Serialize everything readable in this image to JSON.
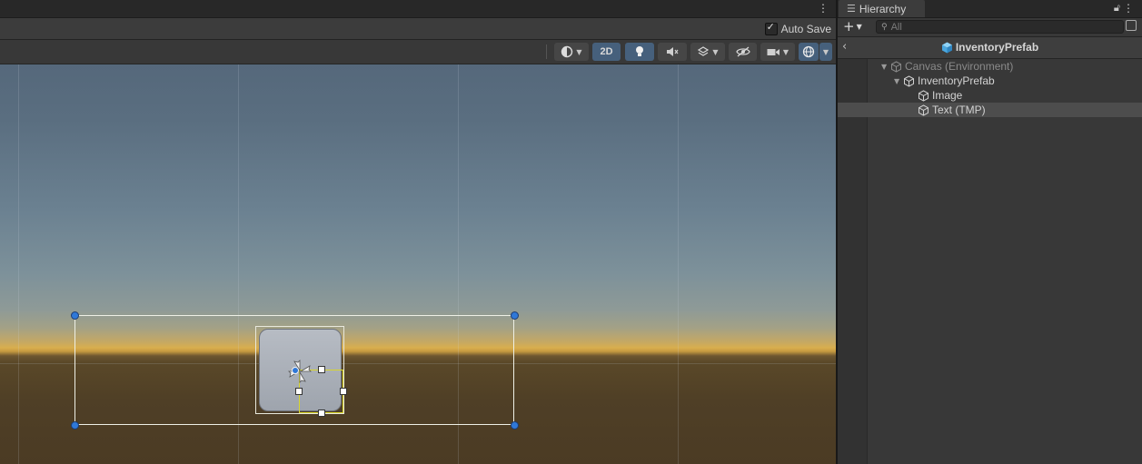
{
  "scene": {
    "autosave_label": "Auto Save",
    "autosave_checked": true,
    "toolbar": {
      "mode_2d_label": "2D",
      "mode_2d_active": true
    }
  },
  "hierarchy": {
    "tab_label": "Hierarchy",
    "search_placeholder": "All",
    "breadcrumb_title": "InventoryPrefab",
    "tree": [
      {
        "label": "Canvas (Environment)",
        "depth": 0,
        "expanded": true,
        "dimmed": true
      },
      {
        "label": "InventoryPrefab",
        "depth": 1,
        "expanded": true
      },
      {
        "label": "Image",
        "depth": 2
      },
      {
        "label": "Text (TMP)",
        "depth": 2,
        "selected": true
      }
    ]
  },
  "colors": {
    "accent_blue": "#46607c",
    "selection_yellow": "#d9d62b",
    "prefab_cube": "#5ab4ea"
  },
  "icons": {
    "scene_kebab": "kebab-menu-icon",
    "shading": "shading-mode-icon",
    "lighting": "lightbulb-icon",
    "audio": "audio-mute-icon",
    "effects": "effects-icon",
    "hidden": "scene-visibility-icon",
    "camera": "camera-icon",
    "gizmos": "gizmos-icon",
    "lock": "lock-icon",
    "prefab": "cube-icon"
  }
}
